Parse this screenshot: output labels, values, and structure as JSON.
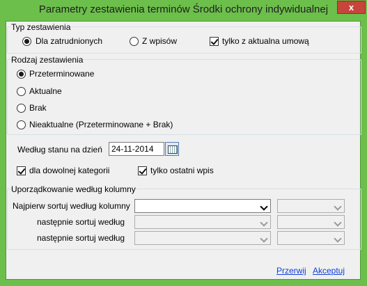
{
  "window": {
    "title": "Parametry zestawienia terminów Środki ochrony indywidualnej",
    "close": "x"
  },
  "typ": {
    "legend": "Typ zestawienia",
    "options": [
      "Dla zatrudnionych",
      "Z wpisów"
    ],
    "selected": 0,
    "current_contract": {
      "label": "tylko z aktualna umową",
      "checked": true
    }
  },
  "rodzaj": {
    "legend": "Rodzaj zestawienia",
    "options": [
      "Przeterminowane",
      "Aktualne",
      "Brak",
      "Nieaktualne (Przeterminowane + Brak)"
    ],
    "selected": 0
  },
  "stan": {
    "label": "Według stanu na dzień",
    "value": "24-11-2014"
  },
  "any_category": {
    "label": "dla dowolnej kategorii",
    "checked": true
  },
  "last_entry": {
    "label": "tylko ostatni wpis",
    "checked": true
  },
  "sort": {
    "legend": "Uporządkowanie według kolumny",
    "first_label": "Najpierw sortuj według kolumny",
    "next_label_1": "następnie sortuj według",
    "next_label_2": "następnie sortuj według"
  },
  "actions": {
    "cancel": "Przerwij",
    "accept": "Akceptuj"
  }
}
